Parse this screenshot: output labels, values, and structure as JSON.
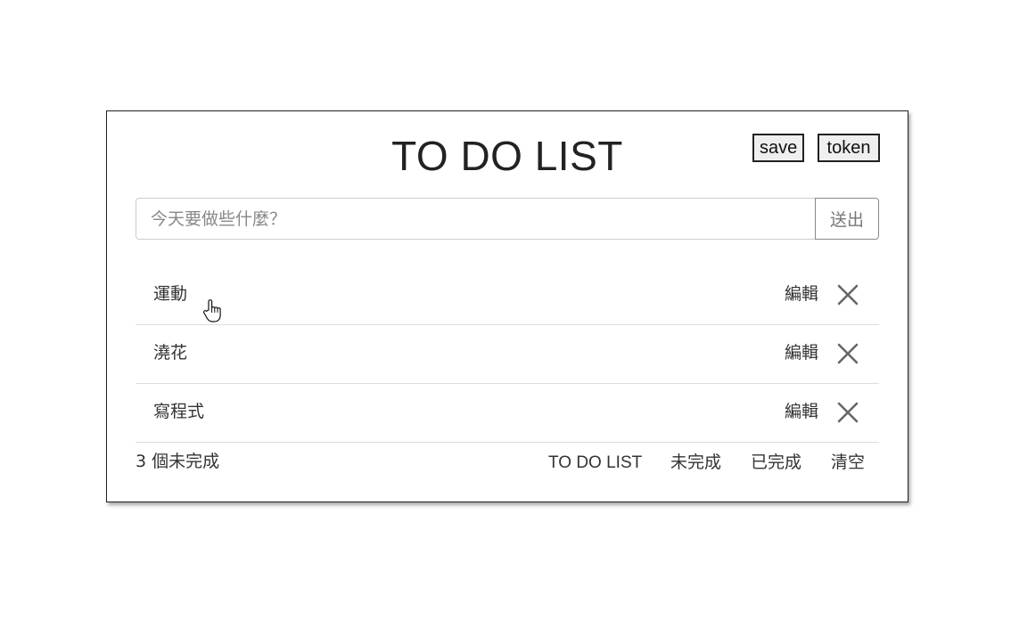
{
  "header": {
    "title": "TO DO LIST",
    "save_label": "save",
    "token_label": "token"
  },
  "input": {
    "placeholder": "今天要做些什麼？",
    "value": "",
    "submit_label": "送出"
  },
  "todos": [
    {
      "text": "運動",
      "edit_label": "編輯"
    },
    {
      "text": "澆花",
      "edit_label": "編輯"
    },
    {
      "text": "寫程式",
      "edit_label": "編輯"
    }
  ],
  "footer": {
    "remaining": "3 個未完成",
    "filters": {
      "all": "TO DO LIST",
      "active": "未完成",
      "completed": "已完成",
      "clear": "清空"
    }
  },
  "icons": {
    "delete": "close-icon",
    "pointer": "hand-pointer-icon"
  },
  "colors": {
    "border": "#222222",
    "divider": "#dddddd",
    "icon": "#666666"
  }
}
